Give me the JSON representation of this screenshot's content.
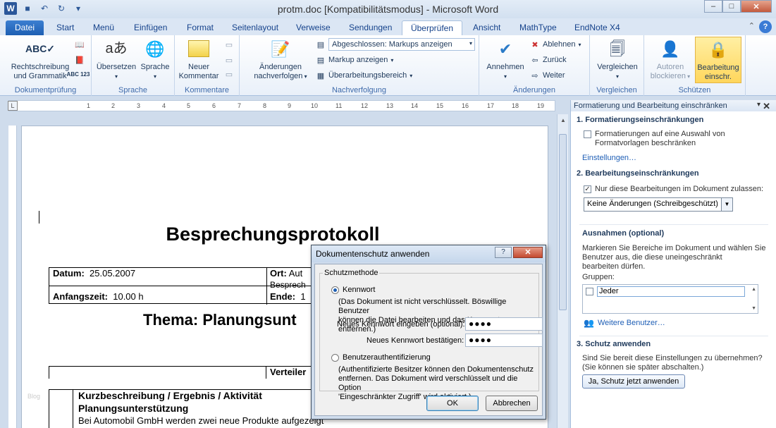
{
  "titlebar": {
    "title": "protm.doc [Kompatibilitätsmodus] - Microsoft Word",
    "app_icon": "W"
  },
  "tabs": [
    "Datei",
    "Start",
    "Menü",
    "Einfügen",
    "Format",
    "Seitenlayout",
    "Verweise",
    "Sendungen",
    "Überprüfen",
    "Ansicht",
    "MathType",
    "EndNote X4"
  ],
  "ribbon": {
    "spelling": "Rechtschreibung\nund Grammatik",
    "g_dokumentpruefung": "Dokumentprüfung",
    "translate": "Übersetzen",
    "language": "Sprache",
    "g_sprache": "Sprache",
    "new_comment": "Neuer\nKommentar",
    "g_kommentare": "Kommentare",
    "track_changes": "Änderungen\nnachverfolgen",
    "markup_dropdown": "Abgeschlossen: Markups anzeigen",
    "show_markup": "Markup anzeigen",
    "review_pane": "Überarbeitungsbereich",
    "g_nachverfolgung": "Nachverfolgung",
    "accept": "Annehmen",
    "reject": "Ablehnen",
    "previous": "Zurück",
    "next": "Weiter",
    "g_aenderungen": "Änderungen",
    "compare": "Vergleichen",
    "g_vergleichen": "Vergleichen",
    "block_authors": "Autoren\nblockieren",
    "restrict_editing": "Bearbeitung\neinschr.",
    "g_schuetzen": "Schützen"
  },
  "ruler": {
    "tab_selector": "L",
    "numbers": [
      "1",
      "2",
      "3",
      "4",
      "5",
      "6",
      "7",
      "8",
      "9",
      "10",
      "11",
      "12",
      "13",
      "14",
      "15",
      "16",
      "17",
      "18",
      "19"
    ]
  },
  "document": {
    "title": "Besprechungsprotokoll",
    "datum_label": "Datum:",
    "datum_value": "25.05.2007",
    "ort_label": "Ort:",
    "ort_value1": "Aut",
    "ort_value2": "Besprech",
    "anfang_label": "Anfangszeit:",
    "anfang_value": "10.00 h",
    "ende_label": "Ende:",
    "ende_value": "1",
    "thema": "Thema: Planungsunt",
    "verteiler": "Verteiler",
    "kurz_header": "Kurzbeschreibung  / Ergebnis  / Aktivität",
    "planung": "Planungsunterstützung",
    "body_line": "Bei Automobil GmbH werden  zwei  neue Produkte aufgezeigt",
    "watermark": "Blog"
  },
  "pane": {
    "title": "Formatierung und Bearbeitung einschränken",
    "s1": "1. Formatierungseinschränkungen",
    "s1_check": "Formatierungen auf eine Auswahl von\nFormatvorlagen beschränken",
    "s1_link": "Einstellungen…",
    "s2": "2. Bearbeitungseinschränkungen",
    "s2_check": "Nur diese Bearbeitungen im Dokument zulassen:",
    "s2_select": "Keine Änderungen (Schreibgeschützt)",
    "exceptions": "Ausnahmen (optional)",
    "exceptions_text": "Markieren Sie Bereiche im Dokument und wählen Sie\nBenutzer aus, die diese uneingeschränkt\nbearbeiten dürfen.",
    "groups_label": "Gruppen:",
    "group_item": "Jeder",
    "more_users": "Weitere Benutzer…",
    "s3": "3. Schutz anwenden",
    "s3_text": "Sind Sie bereit diese Einstellungen zu übernehmen?\n(Sie können sie später abschalten.)",
    "s3_button": "Ja, Schutz jetzt anwenden"
  },
  "dialog": {
    "title": "Dokumentenschutz anwenden",
    "help": "?",
    "close": "✕",
    "legend": "Schutzmethode",
    "opt_password": "Kennwort",
    "password_text": "(Das Dokument ist nicht verschlüsselt. Böswillige Benutzer\nkönnen die Datei bearbeiten und das Kennwort entfernen.)",
    "new_password_label": "Neues Kennwort eingeben (optional):",
    "new_password_value": "●●●●",
    "confirm_label": "Neues Kennwort bestätigen:",
    "confirm_value": "●●●●",
    "opt_auth": "Benutzerauthentifizierung",
    "auth_text": "(Authentifizierte Besitzer können den Dokumentenschutz\nentfernen. Das Dokument wird verschlüsselt und die Option\n'Eingeschränkter Zugriff' wird aktiviert.)",
    "ok": "OK",
    "cancel": "Abbrechen"
  }
}
